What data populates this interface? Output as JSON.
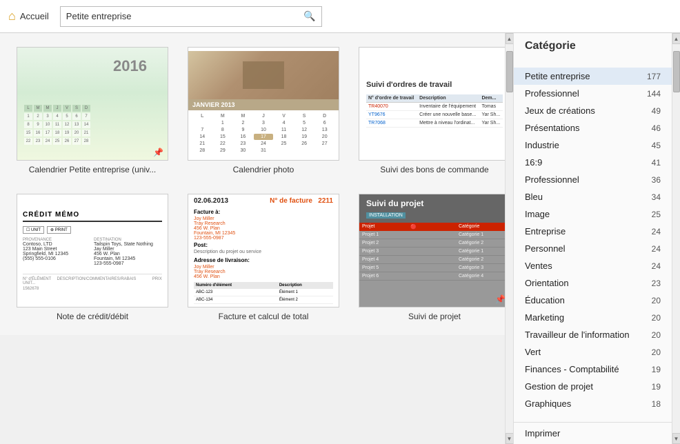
{
  "topbar": {
    "home_label": "Accueil",
    "search_value": "Petite entreprise",
    "search_placeholder": "Petite entreprise"
  },
  "templates": [
    {
      "id": "cal1",
      "type": "calendar-petite",
      "label": "Calendrier Petite entreprise (univ...",
      "pinned": true,
      "year": "2016"
    },
    {
      "id": "cal2",
      "type": "calendar-photo",
      "label": "Calendrier photo",
      "pinned": false,
      "month": "JANVIER 2013"
    },
    {
      "id": "suivi1",
      "type": "suivi-bons",
      "label": "Suivi des bons de commande",
      "pinned": false,
      "title": "Suivi d'ordres de travail",
      "columns": [
        "N° d'ordre de travail",
        "Description",
        "Dema..."
      ],
      "rows": [
        [
          "TR40070",
          "Inventaire de l'équipement",
          "Tomas"
        ],
        [
          "YT9676",
          "Créer une nouvelle base de données clients",
          "Yar Sh..."
        ],
        [
          "TR7068",
          "Mettre à niveau l'ordinateur de bureau",
          "Yar Sh..."
        ]
      ]
    },
    {
      "id": "credit",
      "type": "note-credit",
      "label": "Note de crédit/débit",
      "title": "CRÉDIT MÉMO",
      "actions": [
        "UNIT",
        "PRINT"
      ],
      "from_label": "PROVENANCE",
      "to_label": "DESTINATION"
    },
    {
      "id": "facture",
      "type": "facture",
      "label": "Facture et calcul de total",
      "date": "02.06.2013",
      "invoice_label": "N° de facture",
      "invoice_num": "2211",
      "bill_to": "Facture à:",
      "post": "Post:",
      "table_cols": [
        "Numéro d'élément",
        "Description"
      ],
      "table_rows": [
        [
          "ABC-123",
          "Élément 1"
        ],
        [
          "ABC-134",
          "Élément 2"
        ]
      ]
    },
    {
      "id": "projet",
      "type": "suivi-projet",
      "label": "Suivi de projet",
      "title": "Suivi du projet",
      "badge": "INSTALLATION",
      "pinned": true,
      "columns": [
        "Projet",
        "Catégorie"
      ],
      "rows": [
        [
          "Projet 1",
          "Catégorie 1"
        ],
        [
          "Projet 2",
          "Catégorie 2"
        ],
        [
          "Projet 3",
          "Catégorie 1"
        ],
        [
          "Projet 4",
          "Catégorie 2"
        ],
        [
          "Projet 5",
          "Catégorie 3"
        ],
        [
          "Projet 6",
          "Catégorie 4"
        ]
      ]
    }
  ],
  "sidebar": {
    "title": "Catégorie",
    "items": [
      {
        "label": "Petite entreprise",
        "count": 177,
        "active": true
      },
      {
        "label": "Professionnel",
        "count": 144,
        "active": false
      },
      {
        "label": "Jeux de créations",
        "count": 49,
        "active": false
      },
      {
        "label": "Présentations",
        "count": 46,
        "active": false
      },
      {
        "label": "Industrie",
        "count": 45,
        "active": false
      },
      {
        "label": "16:9",
        "count": 41,
        "active": false
      },
      {
        "label": "Professionnel",
        "count": 36,
        "active": false
      },
      {
        "label": "Bleu",
        "count": 34,
        "active": false
      },
      {
        "label": "Image",
        "count": 25,
        "active": false
      },
      {
        "label": "Entreprise",
        "count": 24,
        "active": false
      },
      {
        "label": "Personnel",
        "count": 24,
        "active": false
      },
      {
        "label": "Ventes",
        "count": 24,
        "active": false
      },
      {
        "label": "Orientation",
        "count": 23,
        "active": false
      },
      {
        "label": "Éducation",
        "count": 20,
        "active": false
      },
      {
        "label": "Marketing",
        "count": 20,
        "active": false
      },
      {
        "label": "Travailleur de l'information",
        "count": 20,
        "active": false
      },
      {
        "label": "Vert",
        "count": 20,
        "active": false
      },
      {
        "label": "Finances - Comptabilité",
        "count": 19,
        "active": false
      },
      {
        "label": "Gestion de projet",
        "count": 19,
        "active": false
      },
      {
        "label": "Graphiques",
        "count": 18,
        "active": false
      }
    ],
    "bottom_item": "Imprimer"
  }
}
